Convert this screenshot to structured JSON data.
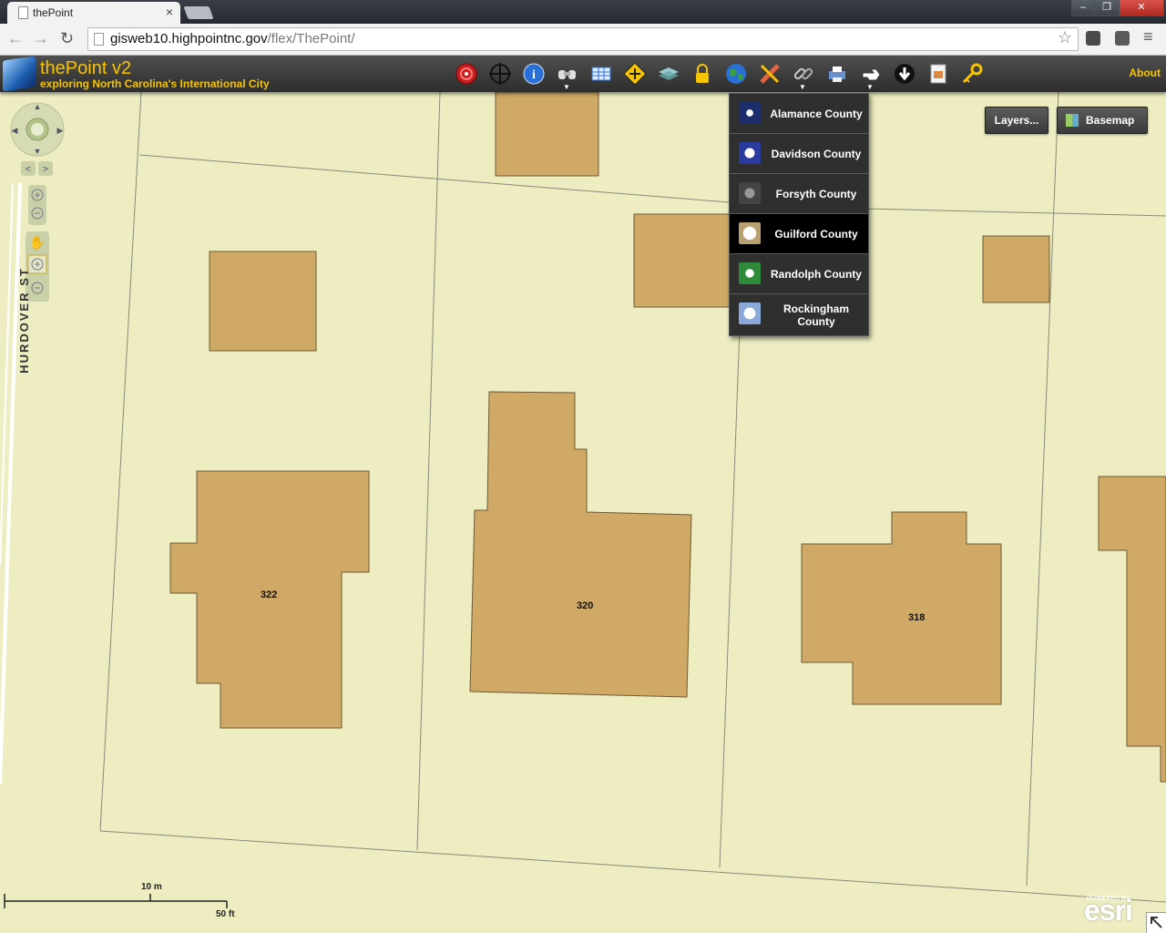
{
  "browser": {
    "tab_title": "thePoint",
    "tab_close": "×",
    "url_host": "gisweb10.highpointnc.gov",
    "url_path": "/flex/ThePoint/",
    "window_buttons": [
      "–",
      "❐",
      "✕"
    ],
    "nav": {
      "back": "←",
      "forward": "→",
      "reload": "↻",
      "star": "☆",
      "menu": "≡"
    }
  },
  "app": {
    "title": "thePoint v2",
    "subtitle": "exploring North Carolina's International City",
    "about_label": "About",
    "toolbar_icons": [
      "target-icon",
      "crosshair-icon",
      "info-icon",
      "binoculars-icon",
      "table-icon",
      "directions-icon",
      "layers-stack-icon",
      "lock-icon",
      "globe-icon",
      "measure-icon",
      "link-icon",
      "print-icon",
      "pointer-icon",
      "download-icon",
      "document-icon",
      "key-icon"
    ]
  },
  "county_menu": {
    "items": [
      {
        "label": "Alamance County",
        "seal_color": "#1c2f6b"
      },
      {
        "label": "Davidson County",
        "seal_color": "#2a3aa0"
      },
      {
        "label": "Forsyth County",
        "seal_color": "#444444"
      },
      {
        "label": "Guilford County",
        "seal_color": "#b8a070"
      },
      {
        "label": "Randolph County",
        "seal_color": "#2f8a3a"
      },
      {
        "label": "Rockingham County",
        "seal_color": "#8aa8d8"
      }
    ],
    "active_index": 3
  },
  "map": {
    "layers_button": "Layers...",
    "basemap_button": "Basemap",
    "street_label": "HURDOVER ST",
    "addresses": [
      "322",
      "320",
      "318"
    ],
    "scale_metric": "10 m",
    "scale_imperial": "50 ft",
    "attribution_small": "POWERED BY",
    "attribution_logo": "esri",
    "colors": {
      "background": "#ededc1",
      "building": "#cfa965",
      "parcel_line": "#8a8a7a"
    }
  }
}
